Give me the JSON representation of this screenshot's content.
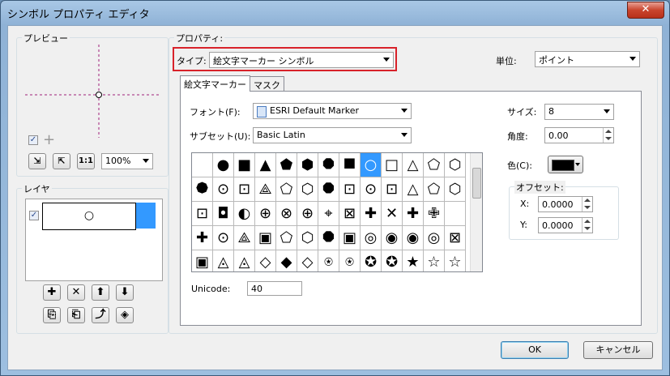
{
  "window": {
    "title": "シンボル プロパティ エディタ",
    "close_glyph": "✕"
  },
  "preview": {
    "label": "プレビュー",
    "zoom": "100%",
    "plus_glyph": "+",
    "zoom_btns": [
      "⇲",
      "⇱",
      "1:1"
    ]
  },
  "layers": {
    "label": "レイヤ",
    "symbol_glyph": "○",
    "buttons": [
      "✚",
      "✕",
      "⬆",
      "⬇"
    ],
    "buttons2": [
      "⎘",
      "⎗",
      "⤴",
      "◈"
    ]
  },
  "properties": {
    "label": "プロパティ:",
    "type_label": "タイプ:",
    "type_value": "絵文字マーカー シンボル",
    "unit_label": "単位:",
    "unit_value": "ポイント",
    "tabs": [
      "絵文字マーカー",
      "マスク"
    ],
    "font_label": "フォント(F):",
    "font_value": "ESRI Default Marker",
    "subset_label": "サブセット(U):",
    "subset_value": "Basic Latin",
    "size_label": "サイズ:",
    "size_value": "8",
    "angle_label": "角度:",
    "angle_value": "0.00",
    "color_label": "色(C):",
    "color_value": "#000000",
    "offset_label": "オフセット:",
    "x_label": "X:",
    "x_value": "0.0000",
    "y_label": "Y:",
    "y_value": "0.0000",
    "unicode_label": "Unicode:",
    "unicode_value": "40"
  },
  "glyphs": [
    [
      "",
      "●",
      "■",
      "▲",
      "⬟",
      "⬢",
      "⯃",
      "⯀",
      "○",
      "□",
      "△",
      "⬠",
      "⬡"
    ],
    [
      "⯄",
      "⊙",
      "⊡",
      "⟁",
      "⬠",
      "⬡",
      "⯃",
      "⊡",
      "⊙",
      "⊡",
      "△",
      "⬠",
      "⬡"
    ],
    [
      "⊡",
      "◘",
      "◐",
      "⊕",
      "⊗",
      "⊕",
      "⌖",
      "⊠",
      "✚",
      "✕",
      "✚",
      "✙",
      ""
    ],
    [
      "✚",
      "⊙",
      "⟁",
      "▣",
      "⬠",
      "⬡",
      "⯃",
      "▣",
      "◎",
      "◉",
      "◉",
      "◎",
      "⊠"
    ],
    [
      "▣",
      "◬",
      "◬",
      "◇",
      "◆",
      "◇",
      "⍟",
      "⍟",
      "✪",
      "✪",
      "★",
      "☆",
      "☆"
    ]
  ],
  "selected_glyph_index": 8,
  "buttons": {
    "ok": "OK",
    "cancel": "キャンセル"
  }
}
